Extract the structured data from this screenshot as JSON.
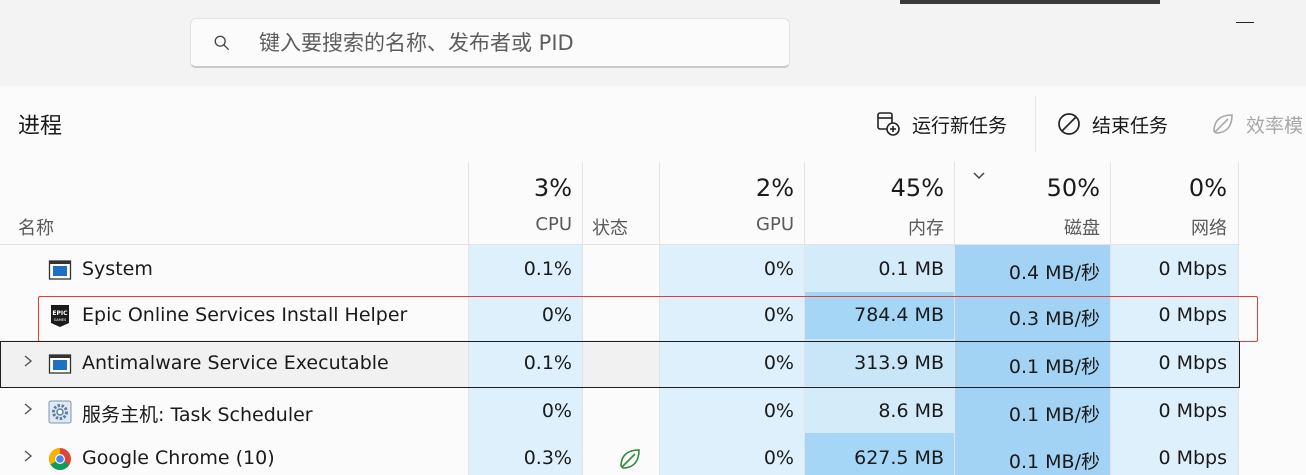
{
  "search": {
    "placeholder": "键入要搜索的名称、发布者或 PID",
    "value": ""
  },
  "page": {
    "title": "进程"
  },
  "commands": {
    "run_new_task": "运行新任务",
    "end_task": "结束任务",
    "efficiency_mode": "效率模"
  },
  "columns": {
    "name": {
      "label": "名称"
    },
    "cpu": {
      "pct": "3%",
      "label": "CPU"
    },
    "status": {
      "label": "状态"
    },
    "gpu": {
      "pct": "2%",
      "label": "GPU"
    },
    "memory": {
      "pct": "45%",
      "label": "内存"
    },
    "disk": {
      "pct": "50%",
      "label": "磁盘"
    },
    "network": {
      "pct": "0%",
      "label": "网络"
    }
  },
  "rows": [
    {
      "name": "System",
      "icon": "system-window-icon",
      "expandable": false,
      "cpu": "0.1%",
      "gpu": "0%",
      "memory": "0.1 MB",
      "disk": "0.4 MB/秒",
      "network": "0 Mbps"
    },
    {
      "name": "Epic Online Services Install Helper",
      "icon": "epic-games-icon",
      "expandable": false,
      "cpu": "0%",
      "gpu": "0%",
      "memory": "784.4 MB",
      "disk": "0.3 MB/秒",
      "network": "0 Mbps"
    },
    {
      "name": "Antimalware Service Executable",
      "icon": "system-window-icon",
      "expandable": true,
      "cpu": "0.1%",
      "gpu": "0%",
      "memory": "313.9 MB",
      "disk": "0.1 MB/秒",
      "network": "0 Mbps"
    },
    {
      "name": "服务主机: Task Scheduler",
      "icon": "gear-icon",
      "expandable": true,
      "cpu": "0%",
      "gpu": "0%",
      "memory": "8.6 MB",
      "disk": "0.1 MB/秒",
      "network": "0 Mbps"
    },
    {
      "name": "Google Chrome (10)",
      "icon": "chrome-icon",
      "expandable": true,
      "status_icon": "leaf-icon",
      "cpu": "0.3%",
      "gpu": "0%",
      "memory": "627.5 MB",
      "disk": "0.1 MB/秒",
      "network": "0 Mbps"
    }
  ],
  "colors": {
    "heat_light": "#def0fb",
    "heat_mid": "#c8e6f8",
    "heat_strong": "#a5d6f5",
    "heat_disk": "#9fd1f3",
    "selection_outline": "#e23b3b"
  }
}
